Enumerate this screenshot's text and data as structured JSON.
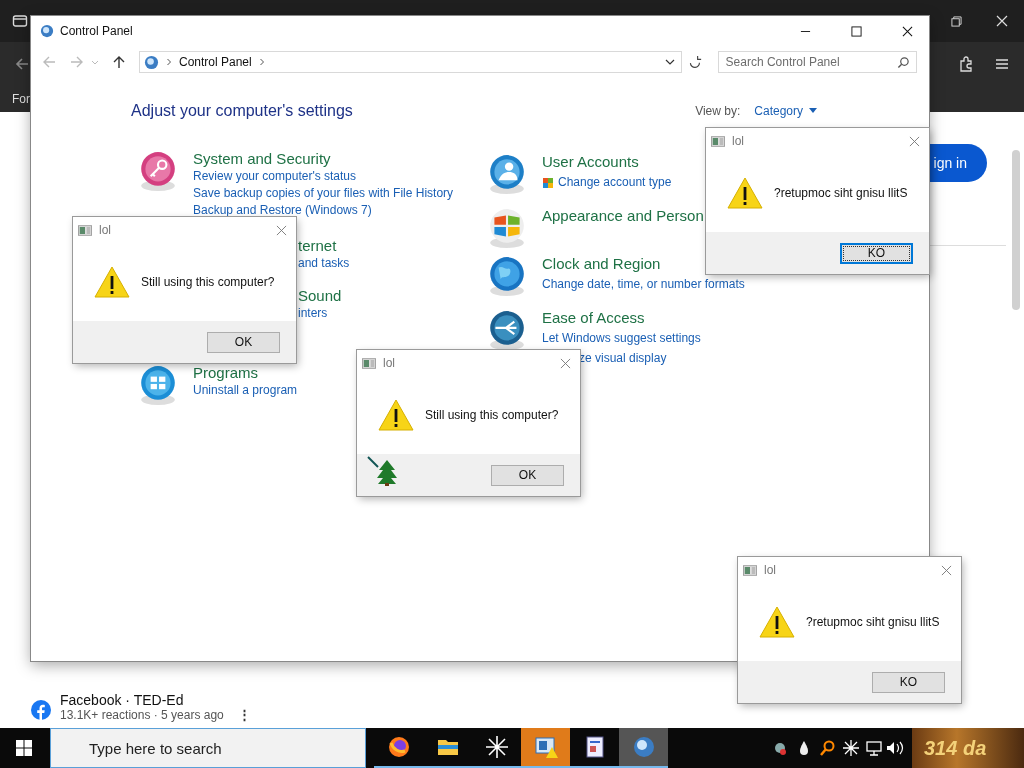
{
  "browser": {
    "bookmark_label": "For",
    "page": {
      "sign_in": "ign in",
      "post": {
        "source": "Facebook · TED-Ed",
        "meta": "13.1K+ reactions · 5 years ago",
        "more": "⋮"
      }
    }
  },
  "control_panel": {
    "title": "Control Panel",
    "breadcrumb": [
      "Control Panel"
    ],
    "search": {
      "placeholder": "Search Control Panel"
    },
    "heading": "Adjust your computer's settings",
    "view_by": {
      "label": "View by:",
      "value": "Category"
    },
    "columns": [
      [
        {
          "kind": "security",
          "heading": {
            "text": "System and Security",
            "kind": "full"
          },
          "links": [
            {
              "text": "Review your computer's status",
              "kind": "full"
            },
            {
              "text": "Save backup copies of your files with File History",
              "kind": "full"
            },
            {
              "text": "Backup and Restore (Windows 7)",
              "kind": "full"
            }
          ]
        },
        {
          "kind": "covered",
          "heading": {
            "text": "ternet",
            "kind": "fragment"
          },
          "links": [
            {
              "text": "and tasks",
              "kind": "fragment"
            }
          ]
        },
        {
          "kind": "covered",
          "heading": {
            "text": "Sound",
            "kind": "fragment"
          },
          "links": [
            {
              "text": "inters",
              "kind": "fragment"
            }
          ]
        },
        {
          "kind": "programs",
          "heading": {
            "text": "Programs",
            "kind": "full"
          },
          "links": [
            {
              "text": "Uninstall a program",
              "kind": "full"
            }
          ]
        }
      ],
      [
        {
          "kind": "users",
          "heading": {
            "text": "User Accounts",
            "kind": "full"
          },
          "links": [
            {
              "text": "Change account type",
              "kind": "shield"
            }
          ]
        },
        {
          "kind": "appearance",
          "heading": {
            "text": "Appearance and Person",
            "kind": "full"
          }
        },
        {
          "kind": "clock",
          "heading": {
            "text": "Clock and Region",
            "kind": "full"
          },
          "links": [
            {
              "text": "Change date, time, or number formats",
              "kind": "full"
            }
          ]
        },
        {
          "kind": "ease",
          "heading": {
            "text": "Ease of Access",
            "kind": "full"
          },
          "links": [
            {
              "text": "Let Windows suggest settings",
              "kind": "full"
            },
            {
              "text": "ze visual display",
              "kind": "fragment"
            }
          ]
        }
      ]
    ]
  },
  "dialogs": [
    {
      "title": "lol",
      "message": "Still using this computer?",
      "button": "OK",
      "focused": false,
      "tree_cursor": false
    },
    {
      "title": "lol",
      "message": "?retupmoc siht gnisu llitS",
      "button": "KO",
      "focused": true,
      "tree_cursor": false
    },
    {
      "title": "lol",
      "message": "Still using this computer?",
      "button": "OK",
      "focused": false,
      "tree_cursor": true
    },
    {
      "title": "lol",
      "message": "?retupmoc siht gnisu llitS",
      "button": "KO",
      "focused": false,
      "tree_cursor": false
    }
  ],
  "taskbar": {
    "search": {
      "placeholder": "Type here to search"
    },
    "apps": [
      {
        "kind": "firefox",
        "flashing": false,
        "selected": false
      },
      {
        "kind": "folder",
        "flashing": false,
        "selected": false
      },
      {
        "kind": "asterisk",
        "flashing": false,
        "selected": false
      },
      {
        "kind": "warning-window",
        "flashing": true,
        "selected": false
      },
      {
        "kind": "document",
        "flashing": false,
        "selected": false
      },
      {
        "kind": "globe",
        "flashing": false,
        "selected": true
      }
    ],
    "widget": "314 da"
  }
}
